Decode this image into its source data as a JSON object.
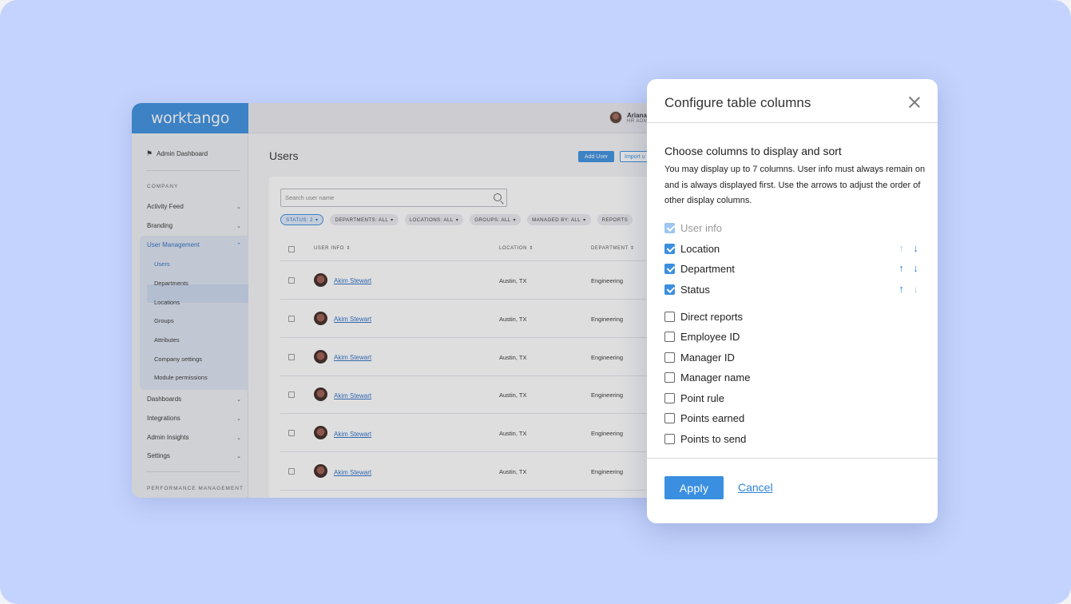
{
  "app": {
    "logo": "worktango",
    "user": {
      "name": "Ariana",
      "role": "HR ADM"
    },
    "sidebar": {
      "dashboard": "Admin Dashboard",
      "section_company": "COMPANY",
      "items": [
        {
          "label": "Activity Feed"
        },
        {
          "label": "Branding"
        },
        {
          "label": "User Management"
        }
      ],
      "sub_items": [
        {
          "label": "Users"
        },
        {
          "label": "Departments"
        },
        {
          "label": "Locations"
        },
        {
          "label": "Groups"
        },
        {
          "label": "Attributes"
        },
        {
          "label": "Company settings"
        },
        {
          "label": "Module permissions"
        }
      ],
      "more_items": [
        {
          "label": "Dashboards"
        },
        {
          "label": "Integrations"
        },
        {
          "label": "Admin Insights"
        },
        {
          "label": "Settings"
        }
      ],
      "section_performance": "PERFORMANCE MANAGEMENT"
    },
    "page_title": "Users",
    "add_user": "Add User",
    "import": "Import u",
    "search_placeholder": "Search user name",
    "filters": [
      "STATUS: 2",
      "DEPARTMENTS: ALL",
      "LOCATIONS: ALL",
      "GROUPS: ALL",
      "MANAGED BY: ALL",
      "REPORTS"
    ],
    "columns": {
      "user_info": "USER INFO",
      "location": "LOCATION",
      "department": "DEPARTMENT"
    },
    "rows": [
      {
        "name": "Akim Stewart",
        "location": "Austin, TX",
        "department": "Engineering"
      },
      {
        "name": "Akim Stewart",
        "location": "Austin, TX",
        "department": "Engineering"
      },
      {
        "name": "Akim Stewart",
        "location": "Austin, TX",
        "department": "Engineering"
      },
      {
        "name": "Akim Stewart",
        "location": "Austin, TX",
        "department": "Engineering"
      },
      {
        "name": "Akim Stewart",
        "location": "Austin, TX",
        "department": "Engineering"
      },
      {
        "name": "Akim Stewart",
        "location": "Austin, TX",
        "department": "Engineering"
      }
    ]
  },
  "modal": {
    "title": "Configure table columns",
    "heading": "Choose columns to display and sort",
    "description": "You may display up to 7 columns. User info must always remain on and is always displayed first. Use the arrows to adjust the order of other display columns.",
    "selected": [
      {
        "label": "User info"
      },
      {
        "label": "Location"
      },
      {
        "label": "Department"
      },
      {
        "label": "Status"
      }
    ],
    "unselected": [
      {
        "label": "Direct reports"
      },
      {
        "label": "Employee ID"
      },
      {
        "label": "Manager ID"
      },
      {
        "label": "Manager name"
      },
      {
        "label": "Point rule"
      },
      {
        "label": "Points earned"
      },
      {
        "label": "Points to send"
      }
    ],
    "apply": "Apply",
    "cancel": "Cancel"
  },
  "colors": {
    "accent": "#3a8fe0",
    "backdrop": "#c4d3fd"
  }
}
